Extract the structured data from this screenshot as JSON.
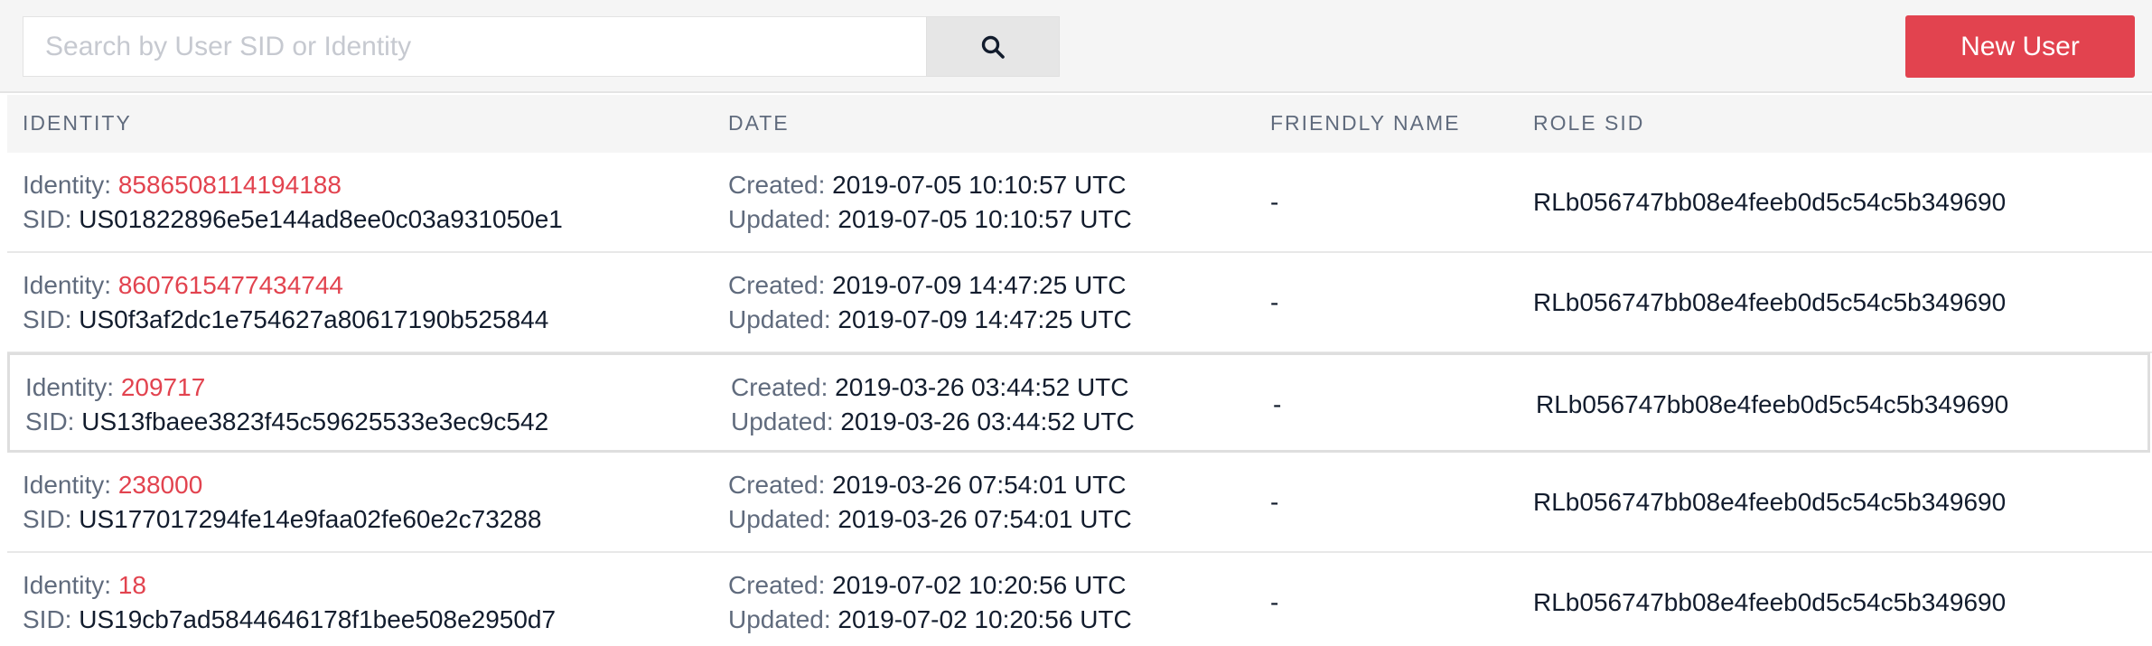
{
  "search": {
    "placeholder": "Search by User SID or Identity",
    "value": ""
  },
  "toolbar": {
    "new_user_label": "New User"
  },
  "columns": [
    "IDENTITY",
    "DATE",
    "FRIENDLY NAME",
    "ROLE SID"
  ],
  "labels": {
    "identity": "Identity: ",
    "sid": "SID: ",
    "created": "Created: ",
    "updated": "Updated: "
  },
  "colors": {
    "accent": "#e2434f",
    "muted": "#606b7d",
    "text": "#121c2d"
  },
  "rows": [
    {
      "identity": "8586508114194188",
      "sid": "US01822896e5e144ad8ee0c03a931050e1",
      "created": "2019-07-05 10:10:57 UTC",
      "updated": "2019-07-05 10:10:57 UTC",
      "friendly_name": "-",
      "role_sid": "RLb056747bb08e4feeb0d5c54c5b349690"
    },
    {
      "identity": "8607615477434744",
      "sid": "US0f3af2dc1e754627a80617190b525844",
      "created": "2019-07-09 14:47:25 UTC",
      "updated": "2019-07-09 14:47:25 UTC",
      "friendly_name": "-",
      "role_sid": "RLb056747bb08e4feeb0d5c54c5b349690"
    },
    {
      "identity": "209717",
      "sid": "US13fbaee3823f45c59625533e3ec9c542",
      "created": "2019-03-26 03:44:52 UTC",
      "updated": "2019-03-26 03:44:52 UTC",
      "friendly_name": "-",
      "role_sid": "RLb056747bb08e4feeb0d5c54c5b349690"
    },
    {
      "identity": "238000",
      "sid": "US177017294fe14e9faa02fe60e2c73288",
      "created": "2019-03-26 07:54:01 UTC",
      "updated": "2019-03-26 07:54:01 UTC",
      "friendly_name": "-",
      "role_sid": "RLb056747bb08e4feeb0d5c54c5b349690"
    },
    {
      "identity": "18",
      "sid": "US19cb7ad5844646178f1bee508e2950d7",
      "created": "2019-07-02 10:20:56 UTC",
      "updated": "2019-07-02 10:20:56 UTC",
      "friendly_name": "-",
      "role_sid": "RLb056747bb08e4feeb0d5c54c5b349690"
    }
  ]
}
